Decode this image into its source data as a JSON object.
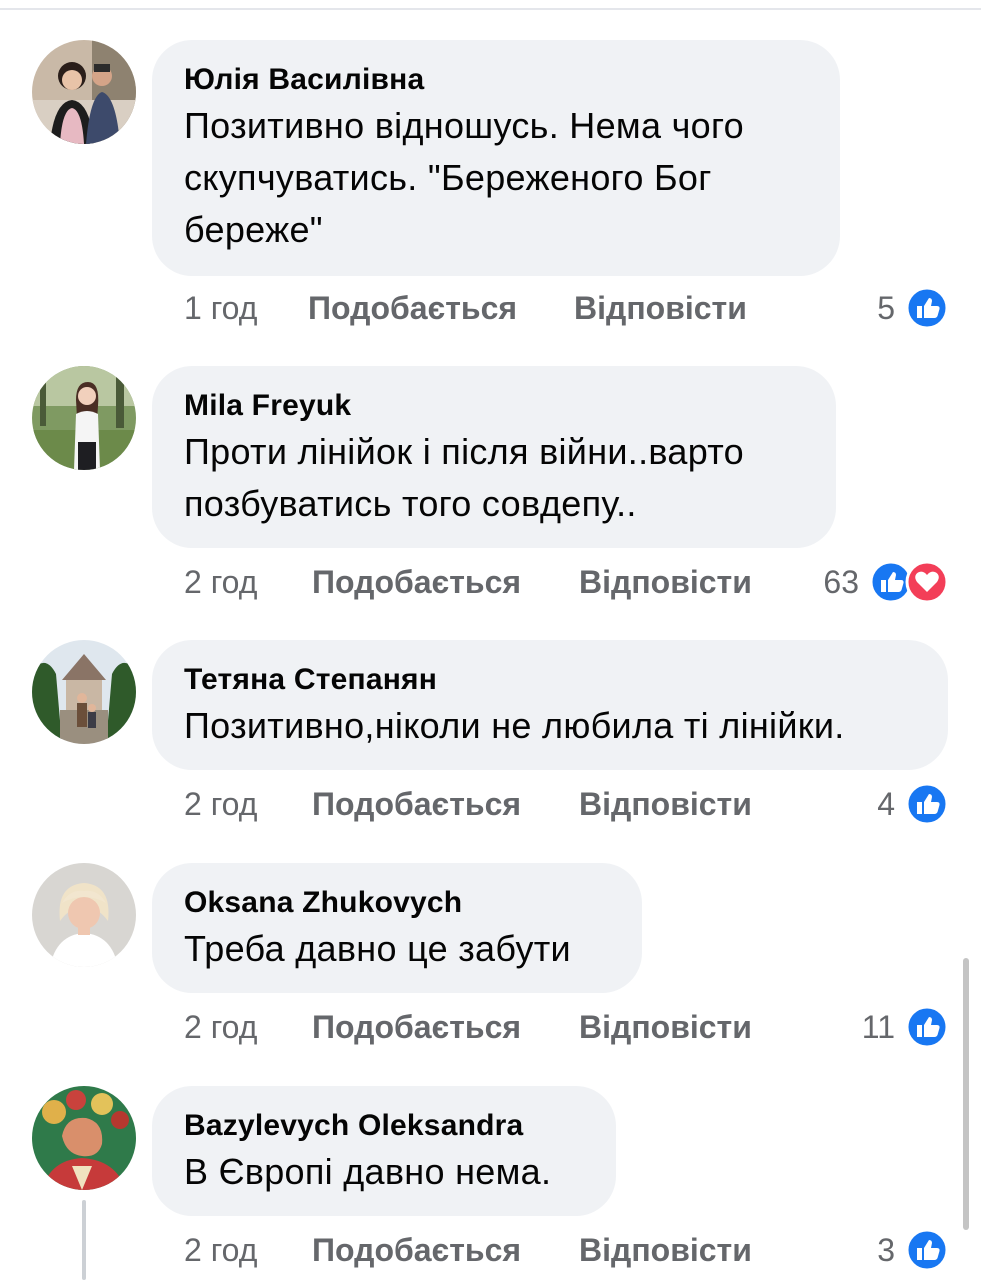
{
  "comments": [
    {
      "author": "Юлія Василівна",
      "lines": [
        "Позитивно відношусь. Нема чого",
        "скупчуватись. \"Береженого Бог",
        "береже\""
      ],
      "time": "1 год",
      "like_label": "Подобається",
      "reply_label": "Відповісти",
      "reaction_count": "5",
      "reactions": [
        "like"
      ]
    },
    {
      "author": "Mila Freyuk",
      "lines": [
        "Проти лінійок і після війни..варто",
        "позбуватись того совдепу.."
      ],
      "time": "2 год",
      "like_label": "Подобається",
      "reply_label": "Відповісти",
      "reaction_count": "63",
      "reactions": [
        "like",
        "love"
      ]
    },
    {
      "author": "Тетяна Степанян",
      "lines": [
        "Позитивно,ніколи не любила ті лінійки."
      ],
      "time": "2 год",
      "like_label": "Подобається",
      "reply_label": "Відповісти",
      "reaction_count": "4",
      "reactions": [
        "like"
      ]
    },
    {
      "author": "Oksana Zhukovych",
      "lines": [
        "Треба давно це забути"
      ],
      "time": "2 год",
      "like_label": "Подобається",
      "reply_label": "Відповісти",
      "reaction_count": "11",
      "reactions": [
        "like"
      ]
    },
    {
      "author": "Bazylevych Oleksandra",
      "lines": [
        "В Європі давно нема."
      ],
      "time": "2 год",
      "like_label": "Подобається",
      "reply_label": "Відповісти",
      "reaction_count": "3",
      "reactions": [
        "like"
      ]
    }
  ],
  "colors": {
    "bubble": "#f0f2f5",
    "meta_text": "#65676b",
    "like_blue": "#1877f2",
    "love_red": "#f33e58"
  },
  "icons": {
    "like": "thumbs-up-icon",
    "love": "heart-icon"
  }
}
